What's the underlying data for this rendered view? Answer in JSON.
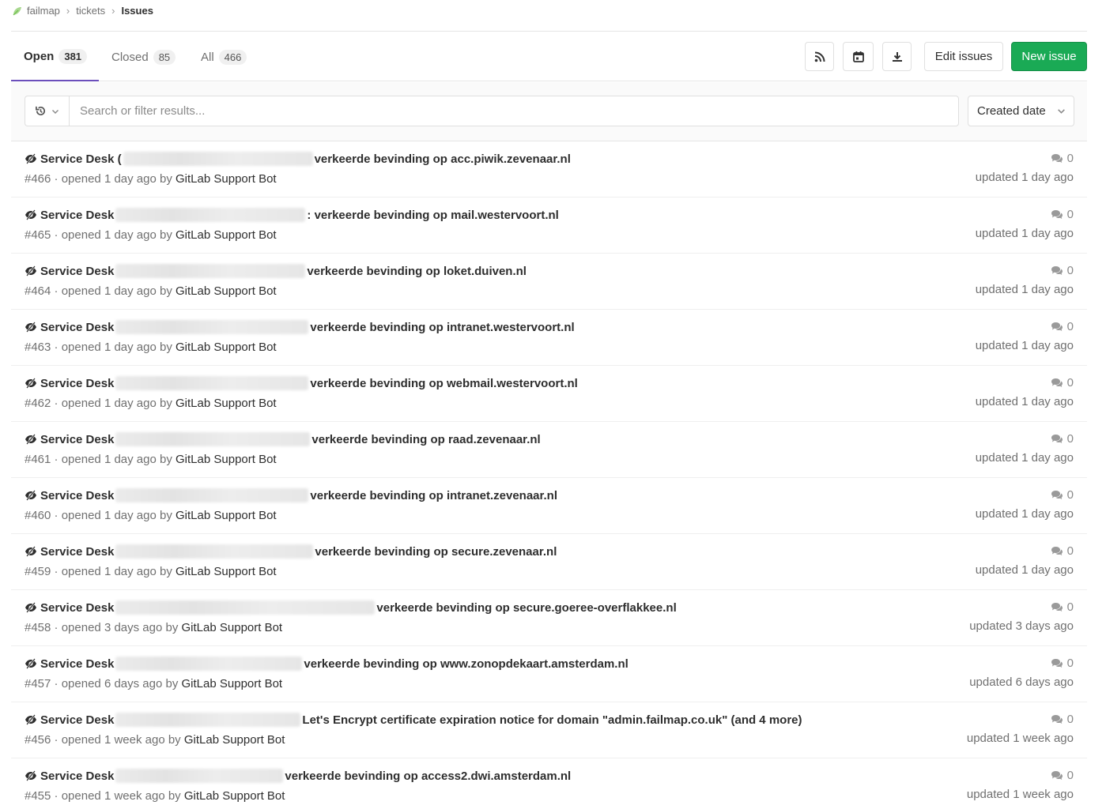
{
  "breadcrumb": {
    "items": [
      "failmap",
      "tickets"
    ],
    "current": "Issues"
  },
  "tabs": [
    {
      "label": "Open",
      "count": "381",
      "active": true
    },
    {
      "label": "Closed",
      "count": "85",
      "active": false
    },
    {
      "label": "All",
      "count": "466",
      "active": false
    }
  ],
  "actions": {
    "rss_icon": "rss-icon",
    "calendar_icon": "calendar-icon",
    "download_icon": "download-icon",
    "edit_label": "Edit issues",
    "new_label": "New issue"
  },
  "filter": {
    "placeholder": "Search or filter results...",
    "sort_label": "Created date"
  },
  "colors": {
    "accent": "#6b4fbb",
    "primary_button": "#1aaa55"
  },
  "issues": [
    {
      "prefix": "Service Desk (",
      "title": "verkeerde bevinding op acc.piwik.zevenaar.nl",
      "number": "#466",
      "opened": "opened 1 day ago by",
      "author": "GitLab Support Bot",
      "comments": "0",
      "updated": "updated 1 day ago"
    },
    {
      "prefix": "Service Desk",
      "title": ": verkeerde bevinding op mail.westervoort.nl",
      "number": "#465",
      "opened": "opened 1 day ago by",
      "author": "GitLab Support Bot",
      "comments": "0",
      "updated": "updated 1 day ago"
    },
    {
      "prefix": "Service Desk",
      "title": "verkeerde bevinding op loket.duiven.nl",
      "number": "#464",
      "opened": "opened 1 day ago by",
      "author": "GitLab Support Bot",
      "comments": "0",
      "updated": "updated 1 day ago"
    },
    {
      "prefix": "Service Desk",
      "title": "verkeerde bevinding op intranet.westervoort.nl",
      "number": "#463",
      "opened": "opened 1 day ago by",
      "author": "GitLab Support Bot",
      "comments": "0",
      "updated": "updated 1 day ago"
    },
    {
      "prefix": "Service Desk",
      "title": "verkeerde bevinding op webmail.westervoort.nl",
      "number": "#462",
      "opened": "opened 1 day ago by",
      "author": "GitLab Support Bot",
      "comments": "0",
      "updated": "updated 1 day ago"
    },
    {
      "prefix": "Service Desk",
      "title": "verkeerde bevinding op raad.zevenaar.nl",
      "number": "#461",
      "opened": "opened 1 day ago by",
      "author": "GitLab Support Bot",
      "comments": "0",
      "updated": "updated 1 day ago"
    },
    {
      "prefix": "Service Desk",
      "title": "verkeerde bevinding op intranet.zevenaar.nl",
      "number": "#460",
      "opened": "opened 1 day ago by",
      "author": "GitLab Support Bot",
      "comments": "0",
      "updated": "updated 1 day ago"
    },
    {
      "prefix": "Service Desk",
      "title": "verkeerde bevinding op secure.zevenaar.nl",
      "number": "#459",
      "opened": "opened 1 day ago by",
      "author": "GitLab Support Bot",
      "comments": "0",
      "updated": "updated 1 day ago"
    },
    {
      "prefix": "Service Desk",
      "title": "verkeerde bevinding op secure.goeree-overflakkee.nl",
      "number": "#458",
      "opened": "opened 3 days ago by",
      "author": "GitLab Support Bot",
      "comments": "0",
      "updated": "updated 3 days ago"
    },
    {
      "prefix": "Service Desk",
      "title": "verkeerde bevinding op www.zonopdekaart.amsterdam.nl",
      "number": "#457",
      "opened": "opened 6 days ago by",
      "author": "GitLab Support Bot",
      "comments": "0",
      "updated": "updated 6 days ago"
    },
    {
      "prefix": "Service Desk",
      "title": "Let's Encrypt certificate expiration notice for domain \"admin.failmap.co.uk\" (and 4 more)",
      "number": "#456",
      "opened": "opened 1 week ago by",
      "author": "GitLab Support Bot",
      "comments": "0",
      "updated": "updated 1 week ago"
    },
    {
      "prefix": "Service Desk",
      "title": "verkeerde bevinding op access2.dwi.amsterdam.nl",
      "number": "#455",
      "opened": "opened 1 week ago by",
      "author": "GitLab Support Bot",
      "comments": "0",
      "updated": "updated 1 week ago"
    }
  ]
}
